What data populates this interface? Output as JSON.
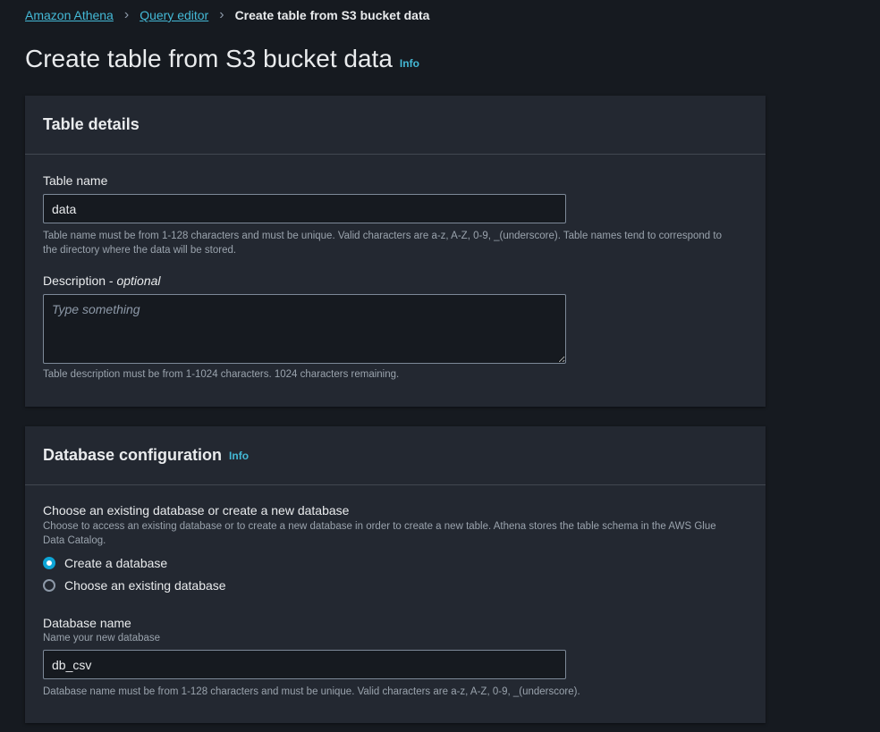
{
  "breadcrumb": [
    "Amazon Athena",
    "Query editor",
    "Create table from S3 bucket data"
  ],
  "page_title": "Create table from S3 bucket data",
  "info_label": "Info",
  "table_details": {
    "title": "Table details",
    "table_name_label": "Table name",
    "table_name_value": "data",
    "table_name_hint": "Table name must be from 1-128 characters and must be unique. Valid characters are a-z, A-Z, 0-9, _(underscore). Table names tend to correspond to the directory where the data will be stored.",
    "description_label": "Description - ",
    "description_optional": "optional",
    "description_placeholder": "Type something",
    "description_hint": "Table description must be from 1-1024 characters. 1024 characters remaining."
  },
  "database_config": {
    "title": "Database configuration",
    "choose_label": "Choose an existing database or create a new database",
    "choose_hint": "Choose to access an existing database or to create a new database in order to create a new table. Athena stores the table schema in the AWS Glue Data Catalog.",
    "options": [
      {
        "label": "Create a database",
        "selected": true
      },
      {
        "label": "Choose an existing database",
        "selected": false
      }
    ],
    "db_name_label": "Database name",
    "db_name_sub": "Name your new database",
    "db_name_value": "db_csv",
    "db_name_hint": "Database name must be from 1-128 characters and must be unique. Valid characters are a-z, A-Z, 0-9, _(underscore)."
  }
}
